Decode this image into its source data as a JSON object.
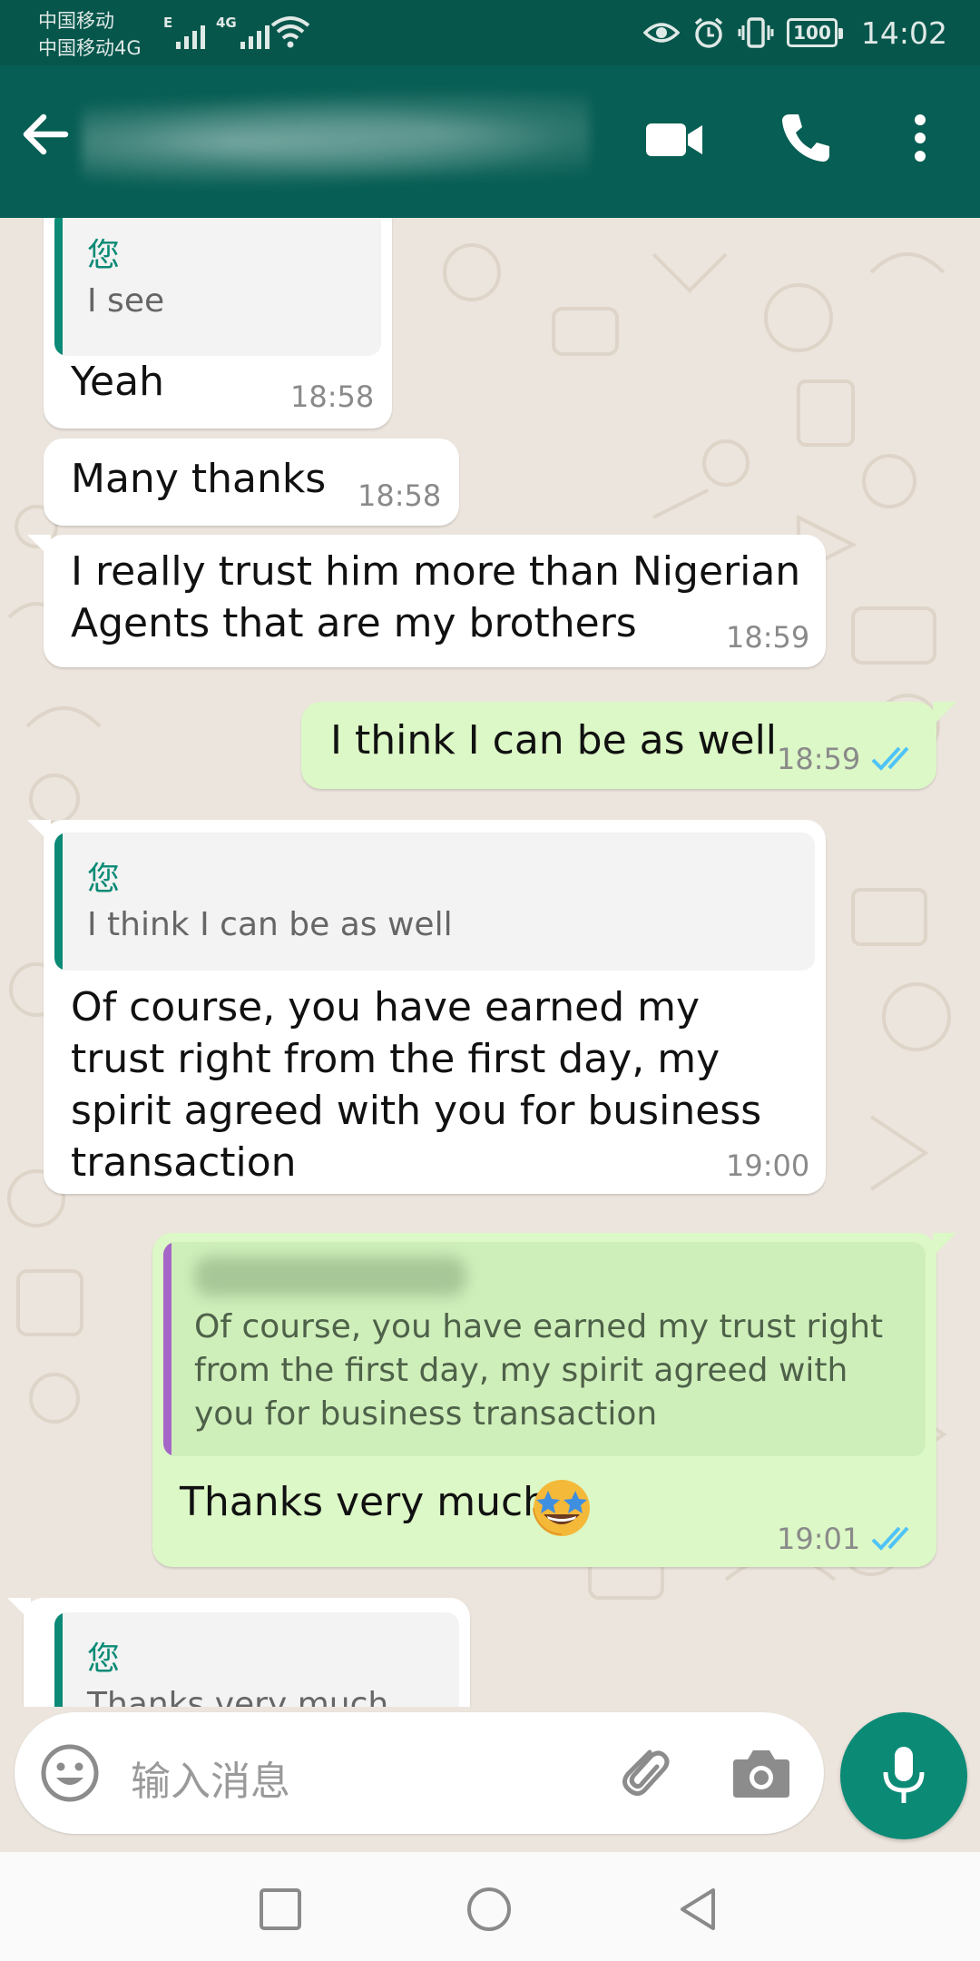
{
  "status_bar": {
    "carrier_1": "中国移动",
    "carrier_2": "中国移动4G",
    "signal_1_label": "E",
    "signal_2_label": "4G",
    "battery": "100",
    "time": "14:02"
  },
  "app_bar": {
    "icons": [
      "back-arrow-icon",
      "video-call-icon",
      "phone-icon",
      "more-vert-icon"
    ]
  },
  "messages": [
    {
      "direction": "incoming",
      "quote_author": "您",
      "quote_text": "I see",
      "text": "Yeah",
      "time": "18:58"
    },
    {
      "direction": "incoming",
      "text": "Many thanks",
      "time": "18:58"
    },
    {
      "direction": "incoming",
      "text_lines": [
        "I really trust him more than Nigerian",
        "Agents that are my brothers"
      ],
      "time": "18:59"
    },
    {
      "direction": "outgoing",
      "text": "I think I can be as well",
      "time": "18:59",
      "status": "read"
    },
    {
      "direction": "incoming",
      "quote_author": "您",
      "quote_text": "I think I can be as well",
      "text_lines": [
        "Of course, you have earned my",
        "trust right from the first day, my",
        "spirit agreed with you for business",
        "transaction"
      ],
      "time": "19:00"
    },
    {
      "direction": "outgoing",
      "quote_text_lines": [
        "Of course, you have earned my trust right",
        "from the first day, my spirit agreed with",
        "you for business transaction"
      ],
      "text": "Thanks very much",
      "emoji": "star-struck-emoji",
      "time": "19:01",
      "status": "read"
    },
    {
      "direction": "incoming",
      "quote_author": "您",
      "quote_text": "Thanks very much"
    }
  ],
  "composer": {
    "placeholder": "输入消息"
  },
  "colors": {
    "header": "#075e54",
    "status_bar": "#07564c",
    "chat_bg": "#ece5dd",
    "incoming_bubble": "#ffffff",
    "outgoing_bubble": "#dcf8c6",
    "accent": "#0b8a76",
    "read_ticks": "#4fc3f7"
  }
}
